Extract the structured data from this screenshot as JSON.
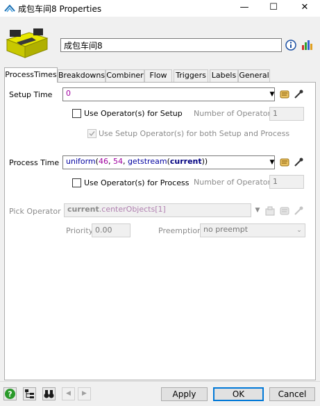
{
  "window": {
    "title": "成包车间8  Properties",
    "minimize_glyph": "—",
    "maximize_glyph": "☐",
    "close_glyph": "✕"
  },
  "header": {
    "object_name": "成包车间8"
  },
  "tabs": [
    {
      "label": "ProcessTimes",
      "active": true
    },
    {
      "label": "Breakdowns"
    },
    {
      "label": "Combiner"
    },
    {
      "label": "Flow"
    },
    {
      "label": "Triggers"
    },
    {
      "label": "Labels"
    },
    {
      "label": "General"
    }
  ],
  "process_times": {
    "setup_time_label": "Setup Time",
    "setup_time_value": "0",
    "use_operators_setup_label": "Use Operator(s) for Setup",
    "number_of_operators_label": "Number of Operators",
    "setup_operators_value": "1",
    "use_setup_for_both_label": "Use Setup Operator(s) for both Setup and Process",
    "process_time_label": "Process Time",
    "process_time_code": {
      "fn": "uniform",
      "open": "(",
      "a": "46",
      "comma1": ", ",
      "b": "54",
      "comma2": ", ",
      "getstream": "getstream",
      "open2": "(",
      "current": "current",
      "close": "))"
    },
    "use_operators_process_label": "Use Operator(s) for Process",
    "process_number_of_operators_label": "Number of Operators",
    "process_operators_value": "1",
    "pick_operator_label": "Pick Operator",
    "pick_operator_code": {
      "current": "current",
      "dot": ".",
      "member": "centerObjects",
      "index": "[1]"
    },
    "priority_label": "Priority",
    "priority_value": "0.00",
    "preemption_label": "Preemption",
    "preemption_value": "no preempt"
  },
  "footer": {
    "apply_label": "Apply",
    "ok_label": "OK",
    "cancel_label": "Cancel",
    "help_glyph": "?",
    "nav_prev_glyph": "◀",
    "nav_next_glyph": "▶"
  },
  "colors": {
    "accent": "#0078d7",
    "processor_yellow": "#d8d800"
  }
}
